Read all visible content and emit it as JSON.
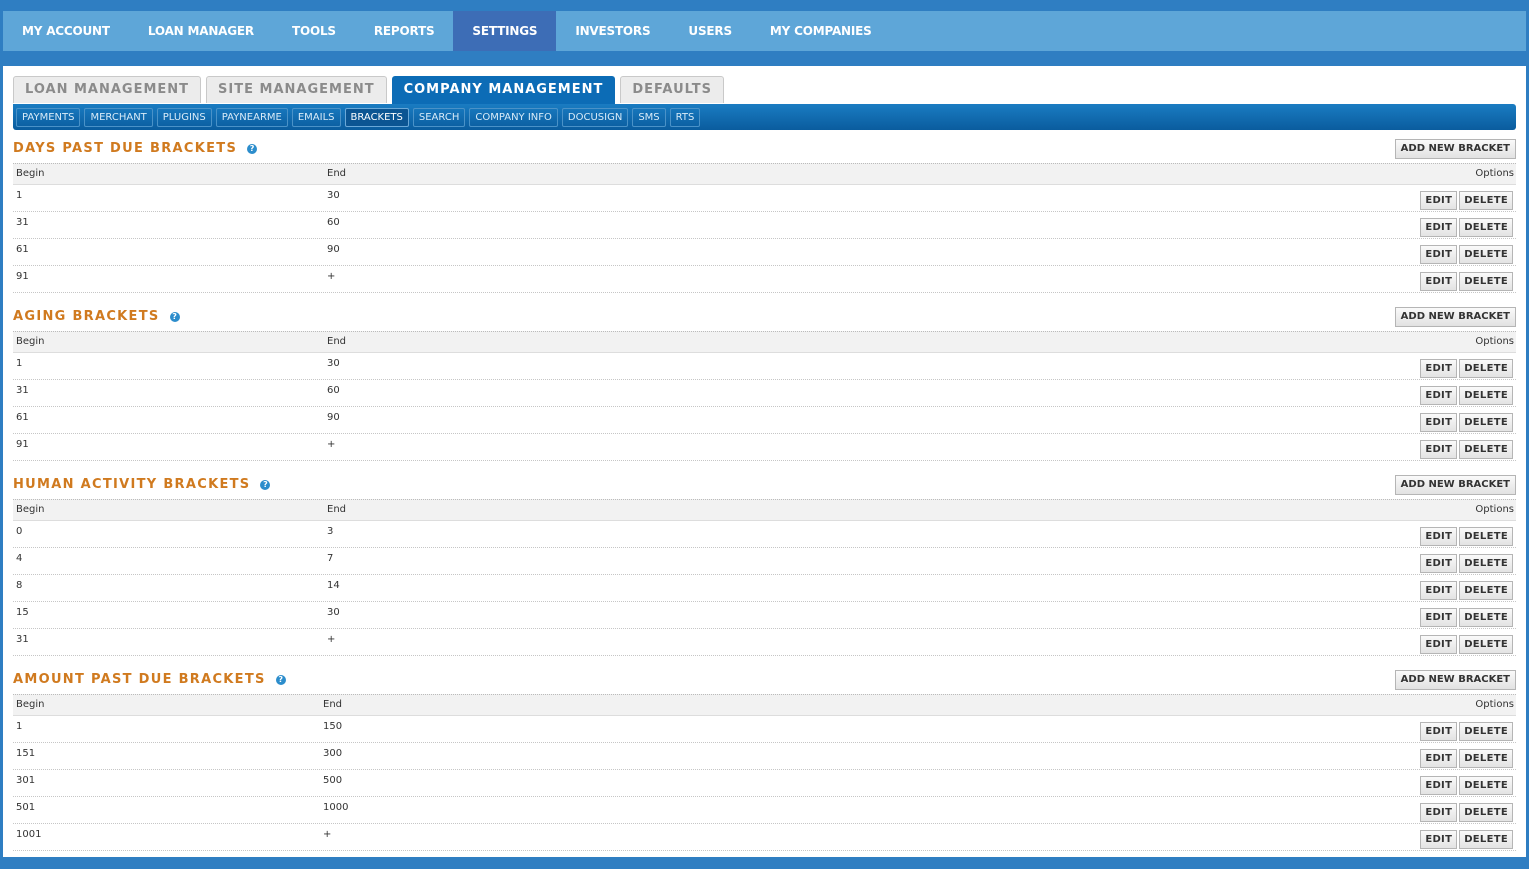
{
  "topnav": [
    "MY ACCOUNT",
    "LOAN MANAGER",
    "TOOLS",
    "REPORTS",
    "SETTINGS",
    "INVESTORS",
    "USERS",
    "MY COMPANIES"
  ],
  "topnav_active": "SETTINGS",
  "maintabs": [
    "LOAN MANAGEMENT",
    "SITE MANAGEMENT",
    "COMPANY MANAGEMENT",
    "DEFAULTS"
  ],
  "maintab_active": "COMPANY MANAGEMENT",
  "subtabs": [
    "PAYMENTS",
    "MERCHANT",
    "PLUGINS",
    "PAYNEARME",
    "EMAILS",
    "BRACKETS",
    "SEARCH",
    "COMPANY INFO",
    "DOCUSIGN",
    "SMS",
    "RTS"
  ],
  "subtab_active": "BRACKETS",
  "labels": {
    "add": "ADD NEW BRACKET",
    "begin": "Begin",
    "end": "End",
    "options": "Options",
    "edit": "EDIT",
    "delete": "DELETE",
    "help": "?"
  },
  "sections": [
    {
      "title": "DAYS PAST DUE BRACKETS",
      "rows": [
        [
          "1",
          "30"
        ],
        [
          "31",
          "60"
        ],
        [
          "61",
          "90"
        ],
        [
          "91",
          "+"
        ]
      ]
    },
    {
      "title": "AGING BRACKETS",
      "rows": [
        [
          "1",
          "30"
        ],
        [
          "31",
          "60"
        ],
        [
          "61",
          "90"
        ],
        [
          "91",
          "+"
        ]
      ]
    },
    {
      "title": "HUMAN ACTIVITY BRACKETS",
      "rows": [
        [
          "0",
          "3"
        ],
        [
          "4",
          "7"
        ],
        [
          "8",
          "14"
        ],
        [
          "15",
          "30"
        ],
        [
          "31",
          "+"
        ]
      ]
    },
    {
      "title": "AMOUNT PAST DUE BRACKETS",
      "rows": [
        [
          "1",
          "150"
        ],
        [
          "151",
          "300"
        ],
        [
          "301",
          "500"
        ],
        [
          "501",
          "1000"
        ],
        [
          "1001",
          "+"
        ]
      ]
    }
  ]
}
